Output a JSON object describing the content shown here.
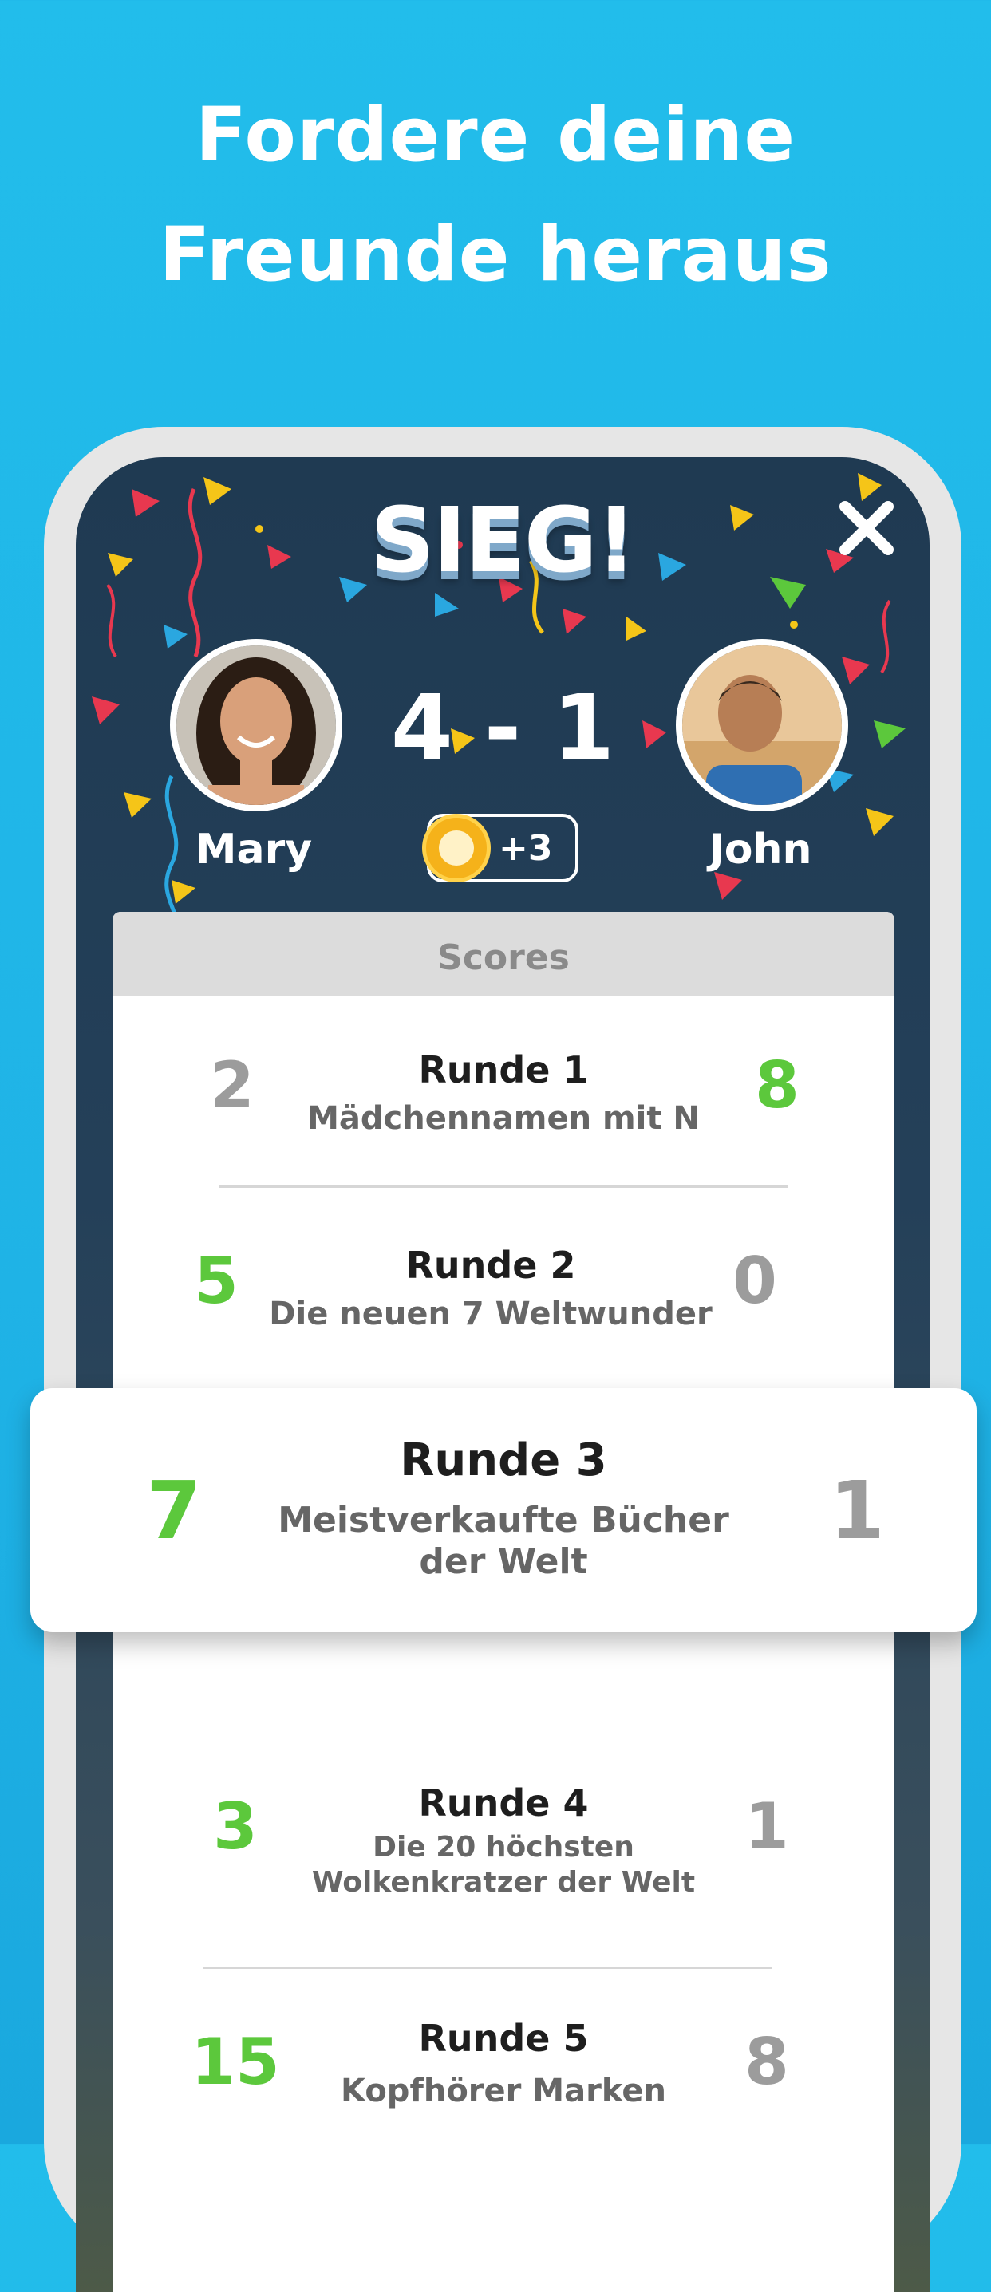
{
  "headline": {
    "line1": "Fordere deine",
    "line2": "Freunde heraus"
  },
  "result": {
    "title": "SIEG!",
    "score": "4 - 1",
    "reward": "+3",
    "player_left": "Mary",
    "player_right": "John"
  },
  "scores": {
    "header": "Scores",
    "rounds": [
      {
        "title": "Runde 1",
        "subtitle": "Mädchennamen mit N",
        "left": "2",
        "right": "8"
      },
      {
        "title": "Runde 2",
        "subtitle": "Die neuen 7 Weltwunder",
        "left": "5",
        "right": "0"
      },
      {
        "title": "Runde 3",
        "subtitle1": "Meistverkaufte Bücher",
        "subtitle2": "der Welt",
        "left": "7",
        "right": "1"
      },
      {
        "title": "Runde 4",
        "subtitle1": "Die 20 höchsten",
        "subtitle2": "Wolkenkratzer der Welt",
        "left": "3",
        "right": "1"
      },
      {
        "title": "Runde 5",
        "subtitle": "Kopfhörer Marken",
        "left": "15",
        "right": "8"
      }
    ]
  },
  "colors": {
    "background": "#22bdeb",
    "win_green": "#5cc83c",
    "lose_gray": "#9c9c9c"
  }
}
